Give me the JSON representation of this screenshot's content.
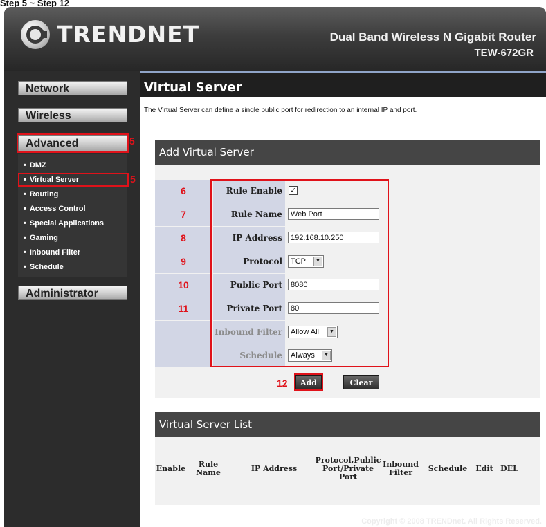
{
  "caption": "Step 5 ~ Step 12",
  "header": {
    "brand": "TRENDNET",
    "product": "Dual Band Wireless N Gigabit Router",
    "model": "TEW-672GR"
  },
  "sidebar": {
    "network": "Network",
    "wireless": "Wireless",
    "advanced": "Advanced",
    "administrator": "Administrator",
    "bullet": "•",
    "subitems": [
      "DMZ",
      "Virtual Server",
      "Routing",
      "Access Control",
      "Special Applications",
      "Gaming",
      "Inbound Filter",
      "Schedule"
    ],
    "callout_advanced": "5",
    "callout_vs": "5"
  },
  "page": {
    "title": "Virtual Server",
    "description": "The Virtual Server can define a single public port for redirection to an internal IP and port."
  },
  "form": {
    "header": "Add Virtual Server",
    "steps": [
      "6",
      "7",
      "8",
      "9",
      "10",
      "11",
      "",
      ""
    ],
    "labels": {
      "rule_enable": "Rule Enable",
      "rule_name": "Rule Name",
      "ip_address": "IP Address",
      "protocol": "Protocol",
      "public_port": "Public Port",
      "private_port": "Private Port",
      "inbound_filter": "Inbound Filter",
      "schedule": "Schedule"
    },
    "values": {
      "rule_enable_mark": "✓",
      "rule_name": "Web Port",
      "ip_address": "192.168.10.250",
      "protocol": "TCP",
      "public_port": "8080",
      "private_port": "80",
      "inbound_filter": "Allow All",
      "schedule": "Always"
    },
    "dropdown_arrow": "▼",
    "add_label": "Add",
    "clear_label": "Clear",
    "add_step": "12"
  },
  "list": {
    "header": "Virtual Server List",
    "columns": [
      "Enable",
      "Rule Name",
      "IP Address",
      "Protocol,Public Port/Private Port",
      "Inbound Filter",
      "Schedule",
      "Edit",
      "DEL"
    ]
  },
  "footer": {
    "copyright": "Copyright © 2008 TRENDnet. All Rights Reserved."
  },
  "colors": {
    "accent_red": "#e0121a",
    "label_bg": "#d2d6e5",
    "panel_dark": "#2c2c2c"
  }
}
